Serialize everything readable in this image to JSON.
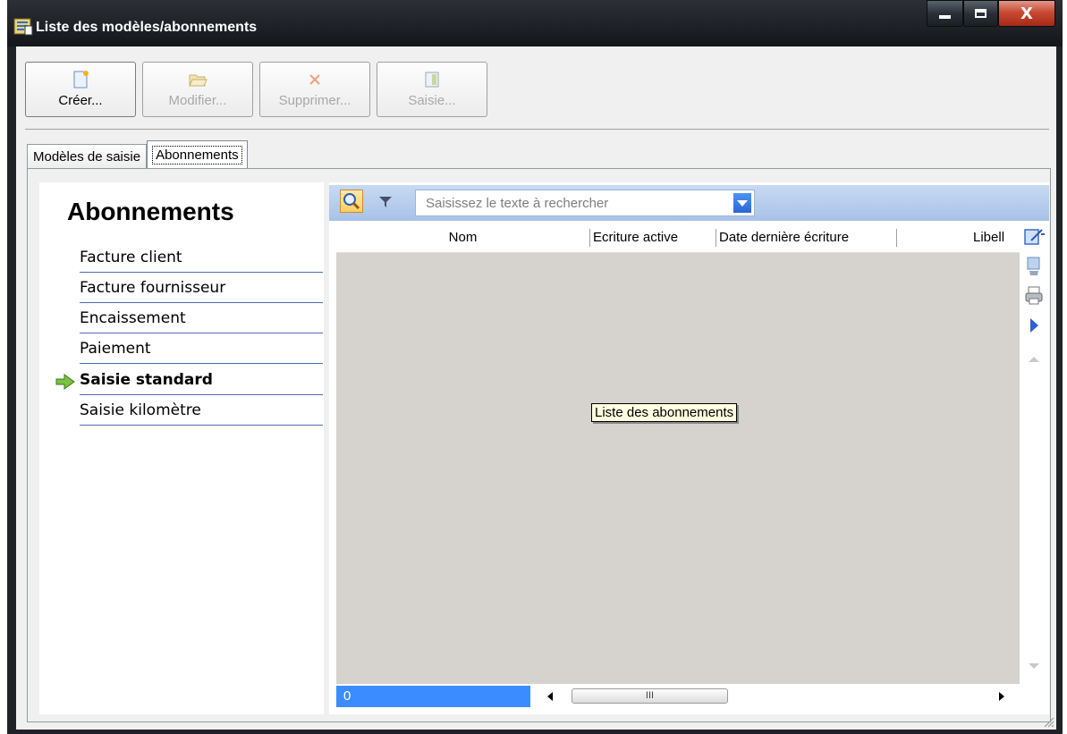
{
  "window": {
    "title": "Liste des modèles/abonnements",
    "controls": [
      "minimize",
      "maximize",
      "close"
    ]
  },
  "toolbar": {
    "buttons": [
      {
        "label": "Créer...",
        "icon": "new-document-icon",
        "enabled": true
      },
      {
        "label": "Modifier...",
        "icon": "open-folder-icon",
        "enabled": false
      },
      {
        "label": "Supprimer...",
        "icon": "delete-x-icon",
        "enabled": false
      },
      {
        "label": "Saisie...",
        "icon": "entry-form-icon",
        "enabled": false
      }
    ]
  },
  "tabs": [
    {
      "label": "Modèles de saisie",
      "active": false
    },
    {
      "label": "Abonnements",
      "active": true
    }
  ],
  "nav": {
    "title": "Abonnements",
    "items": [
      {
        "label": "Facture client",
        "selected": false
      },
      {
        "label": "Facture fournisseur",
        "selected": false
      },
      {
        "label": "Encaissement",
        "selected": false
      },
      {
        "label": "Paiement",
        "selected": false
      },
      {
        "label": "Saisie standard",
        "selected": true
      },
      {
        "label": "Saisie kilomètre",
        "selected": false
      }
    ]
  },
  "grid": {
    "search_placeholder": "Saisissez le texte à rechercher",
    "columns": [
      "Nom",
      "Ecriture active",
      "Date dernière écriture",
      "Libell"
    ],
    "tooltip": "Liste des abonnements",
    "record_count": "0",
    "scroll_thumb_glyph": "III",
    "side_tools": [
      "edit-columns-icon",
      "export-icon",
      "print-icon",
      "next-arrow-icon"
    ]
  },
  "colors": {
    "titlebar": "#1f2328",
    "grid_header": "#b8cfee",
    "nav_underline": "#4d6cb3",
    "grid_body": "#d6d3ce",
    "count_bar": "#3b8dff"
  }
}
